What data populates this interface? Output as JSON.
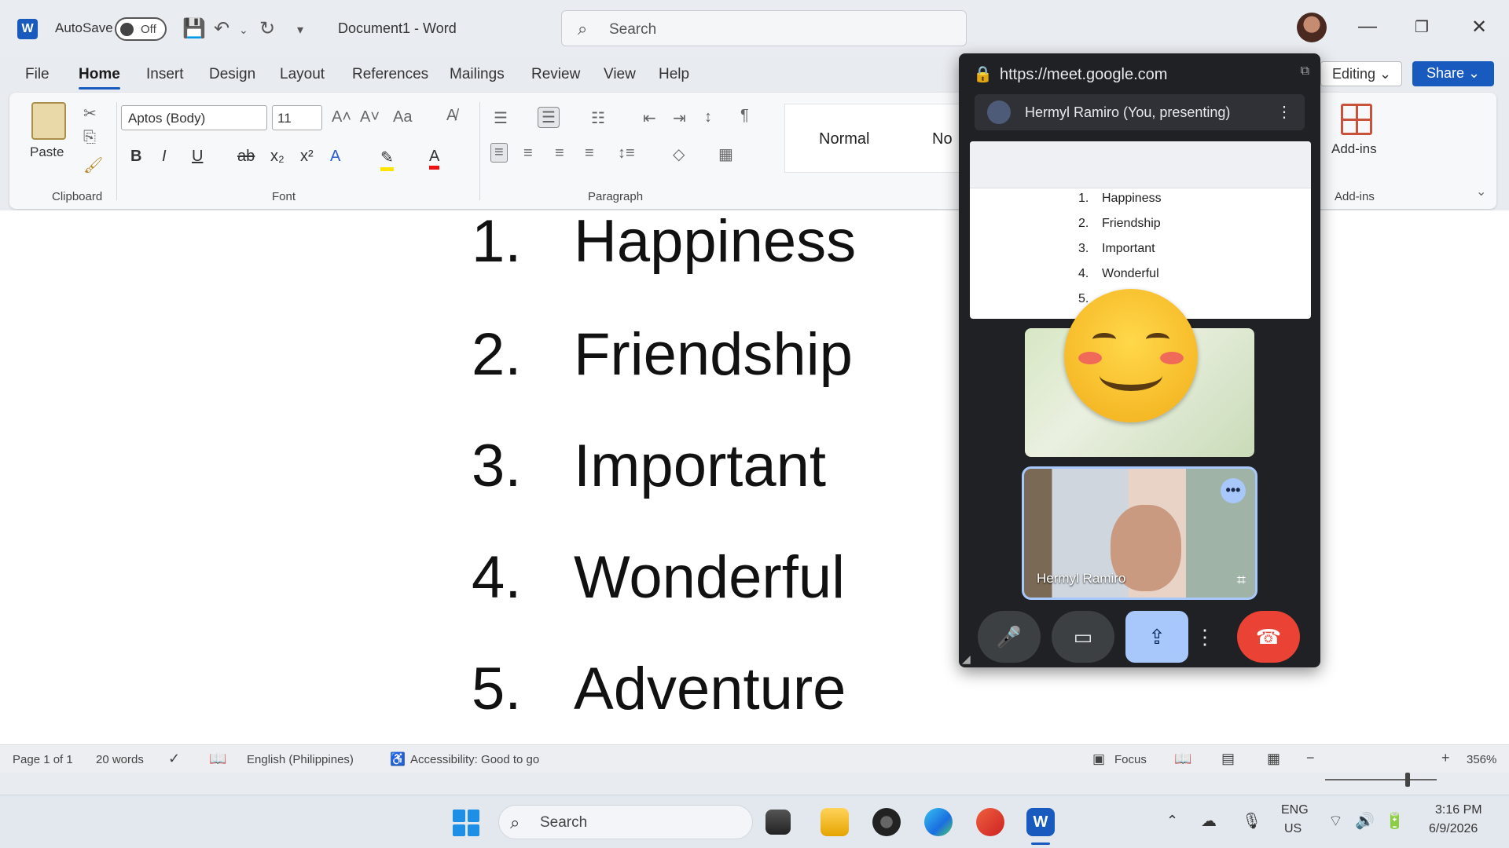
{
  "titlebar": {
    "word_logo": "W",
    "autosave_label": "AutoSave",
    "autosave_state": "Off",
    "document_title": "Document1  -  Word",
    "search_placeholder": "Search"
  },
  "ribbon_tabs": [
    "File",
    "Home",
    "Insert",
    "Design",
    "Layout",
    "References",
    "Mailings",
    "Review",
    "View",
    "Help"
  ],
  "active_tab": "Home",
  "right_buttons": {
    "editing": "Editing",
    "share": "Share"
  },
  "ribbon": {
    "paste_label": "Paste",
    "font_name": "Aptos (Body)",
    "font_size": "11",
    "style_normal": "Normal",
    "style_no_spacing": "No",
    "addins_label": "Add-ins",
    "groups": {
      "clipboard": "Clipboard",
      "font": "Font",
      "paragraph": "Paragraph",
      "addins": "Add-ins"
    }
  },
  "document": {
    "items": [
      {
        "num": "1.",
        "text": "Happiness"
      },
      {
        "num": "2.",
        "text": "Friendship"
      },
      {
        "num": "3.",
        "text": "Important"
      },
      {
        "num": "4.",
        "text": "Wonderful"
      },
      {
        "num": "5.",
        "text": "Adventure"
      }
    ]
  },
  "status": {
    "page": "Page 1 of 1",
    "words": "20 words",
    "language": "English (Philippines)",
    "accessibility": "Accessibility: Good to go",
    "focus": "Focus",
    "zoom": "356%"
  },
  "meet": {
    "url": "https://meet.google.com",
    "presenter": "Hermyl Ramiro (You, presenting)",
    "thumbnail_items": [
      {
        "num": "1.",
        "text": "Happiness"
      },
      {
        "num": "2.",
        "text": "Friendship"
      },
      {
        "num": "3.",
        "text": "Important"
      },
      {
        "num": "4.",
        "text": "Wonderful"
      },
      {
        "num": "5.",
        "text": ""
      }
    ],
    "tile_name": "Hermyl Ramiro",
    "reaction": "smiling-face-emoji"
  },
  "taskbar": {
    "search": "Search",
    "lang_top": "ENG",
    "lang_bottom": "US",
    "time": "3:16 PM",
    "date": "6/9/2026"
  },
  "colors": {
    "word_blue": "#185abd",
    "meet_bg": "#202124",
    "hangup_red": "#ea4335",
    "present_blue": "#a8c7fa"
  }
}
